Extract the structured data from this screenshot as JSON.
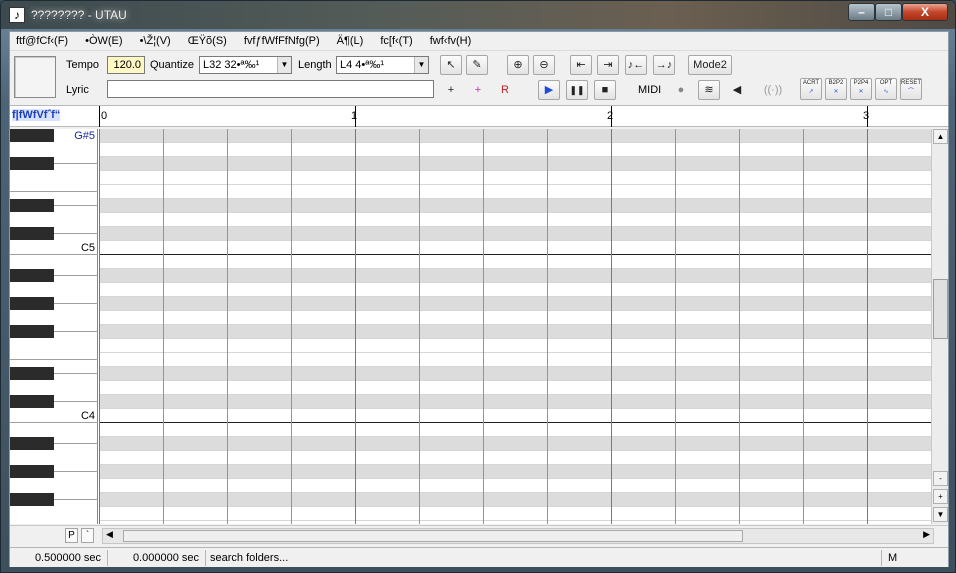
{
  "window": {
    "title": "???????? - UTAU",
    "controls": {
      "minimize": "–",
      "maximize": "□",
      "close": "X"
    }
  },
  "menu": [
    "ftf@fCf‹(F)",
    "•ÒW(E)",
    "•\\Ž¦(V)",
    "ŒŸõ(S)",
    "fvfƒfWfFfNfg(P)",
    "Ä¶(L)",
    "fc[f‹(T)",
    "fwf‹fv(H)"
  ],
  "toolbar": {
    "tempo_label": "Tempo",
    "tempo_value": "120.0",
    "quantize_label": "Quantize",
    "quantize_value": "L32  32•ª‰¹",
    "length_label": "Length",
    "length_value": "L4  4•ª‰¹",
    "lyric_label": "Lyric",
    "lyric_value": "",
    "midi_label": "MIDI",
    "mode_button": "Mode2",
    "icons": {
      "arrow": "↖",
      "pencil": "✎",
      "zoom_in": "⊕",
      "zoom_out": "⊖",
      "to_start": "⇤",
      "to_end": "⇥",
      "prev": "♪←",
      "next": "→♪",
      "play": "▶",
      "pause": "❚❚",
      "stop": "■",
      "insert_note": "+",
      "insert_rest": "R",
      "midi_rec": "●",
      "midi_port": "≋",
      "speaker": "◀"
    },
    "tools": [
      "ACRT",
      "B2P2",
      "P2P4",
      "OPT",
      "RESET"
    ]
  },
  "ruler": {
    "label": "f|fWfVfˆf“",
    "bars": [
      "0",
      "1",
      "2",
      "3"
    ]
  },
  "keyboard": {
    "labels": {
      "top": "G#5",
      "c5": "C5",
      "c4": "C4"
    }
  },
  "bottom": {
    "p_button": "P",
    "quote_button": "`"
  },
  "status": {
    "position": "0.500000 sec",
    "selection": "0.000000 sec",
    "message": "search folders...",
    "mode": "M"
  },
  "colors": {
    "bar_line": "#d23ad2",
    "beat_line": "#8a8ae0",
    "black_row": "#dcdcdc"
  }
}
